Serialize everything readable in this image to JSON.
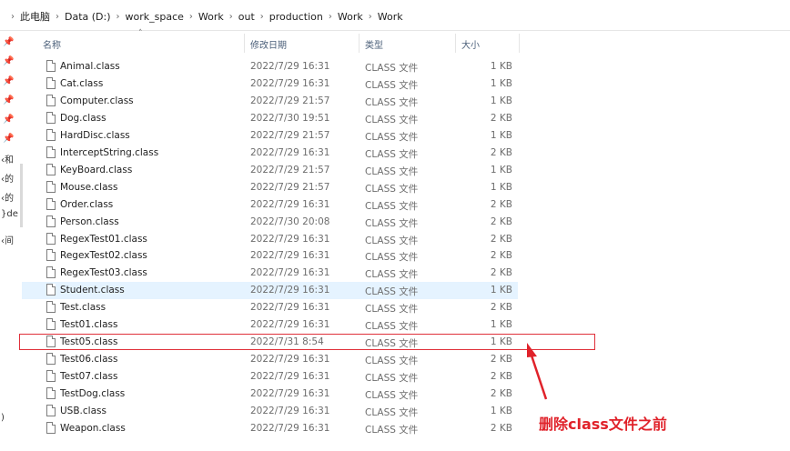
{
  "breadcrumb": [
    "此电脑",
    "Data (D:)",
    "work_space",
    "Work",
    "out",
    "production",
    "Work",
    "Work"
  ],
  "headers": {
    "name": "名称",
    "date": "修改日期",
    "type": "类型",
    "size": "大小"
  },
  "left_pane": {
    "pins": [
      "📌",
      "📌",
      "📌",
      "📌",
      "📌",
      "📌"
    ],
    "texts": [
      "‹和",
      "‹的",
      "‹的",
      "}de",
      "‹间",
      ")"
    ]
  },
  "files": [
    {
      "name": "Animal.class",
      "date": "2022/7/29 16:31",
      "type": "CLASS 文件",
      "size": "1 KB"
    },
    {
      "name": "Cat.class",
      "date": "2022/7/29 16:31",
      "type": "CLASS 文件",
      "size": "1 KB"
    },
    {
      "name": "Computer.class",
      "date": "2022/7/29 21:57",
      "type": "CLASS 文件",
      "size": "1 KB"
    },
    {
      "name": "Dog.class",
      "date": "2022/7/30 19:51",
      "type": "CLASS 文件",
      "size": "2 KB"
    },
    {
      "name": "HardDisc.class",
      "date": "2022/7/29 21:57",
      "type": "CLASS 文件",
      "size": "1 KB"
    },
    {
      "name": "InterceptString.class",
      "date": "2022/7/29 16:31",
      "type": "CLASS 文件",
      "size": "2 KB"
    },
    {
      "name": "KeyBoard.class",
      "date": "2022/7/29 21:57",
      "type": "CLASS 文件",
      "size": "1 KB"
    },
    {
      "name": "Mouse.class",
      "date": "2022/7/29 21:57",
      "type": "CLASS 文件",
      "size": "1 KB"
    },
    {
      "name": "Order.class",
      "date": "2022/7/29 16:31",
      "type": "CLASS 文件",
      "size": "2 KB"
    },
    {
      "name": "Person.class",
      "date": "2022/7/30 20:08",
      "type": "CLASS 文件",
      "size": "2 KB"
    },
    {
      "name": "RegexTest01.class",
      "date": "2022/7/29 16:31",
      "type": "CLASS 文件",
      "size": "2 KB"
    },
    {
      "name": "RegexTest02.class",
      "date": "2022/7/29 16:31",
      "type": "CLASS 文件",
      "size": "2 KB"
    },
    {
      "name": "RegexTest03.class",
      "date": "2022/7/29 16:31",
      "type": "CLASS 文件",
      "size": "2 KB"
    },
    {
      "name": "Student.class",
      "date": "2022/7/29 16:31",
      "type": "CLASS 文件",
      "size": "1 KB"
    },
    {
      "name": "Test.class",
      "date": "2022/7/29 16:31",
      "type": "CLASS 文件",
      "size": "2 KB"
    },
    {
      "name": "Test01.class",
      "date": "2022/7/29 16:31",
      "type": "CLASS 文件",
      "size": "1 KB"
    },
    {
      "name": "Test05.class",
      "date": "2022/7/31 8:54",
      "type": "CLASS 文件",
      "size": "1 KB"
    },
    {
      "name": "Test06.class",
      "date": "2022/7/29 16:31",
      "type": "CLASS 文件",
      "size": "2 KB"
    },
    {
      "name": "Test07.class",
      "date": "2022/7/29 16:31",
      "type": "CLASS 文件",
      "size": "2 KB"
    },
    {
      "name": "TestDog.class",
      "date": "2022/7/29 16:31",
      "type": "CLASS 文件",
      "size": "2 KB"
    },
    {
      "name": "USB.class",
      "date": "2022/7/29 16:31",
      "type": "CLASS 文件",
      "size": "1 KB"
    },
    {
      "name": "Weapon.class",
      "date": "2022/7/29 16:31",
      "type": "CLASS 文件",
      "size": "2 KB"
    }
  ],
  "hovered_file": "Student.class",
  "highlighted_file": "Test05.class",
  "annotation": "删除class文件之前",
  "colors": {
    "annotation": "#e0222a",
    "highlight_box": "#e0303a",
    "hover_row": "#e5f3ff"
  }
}
